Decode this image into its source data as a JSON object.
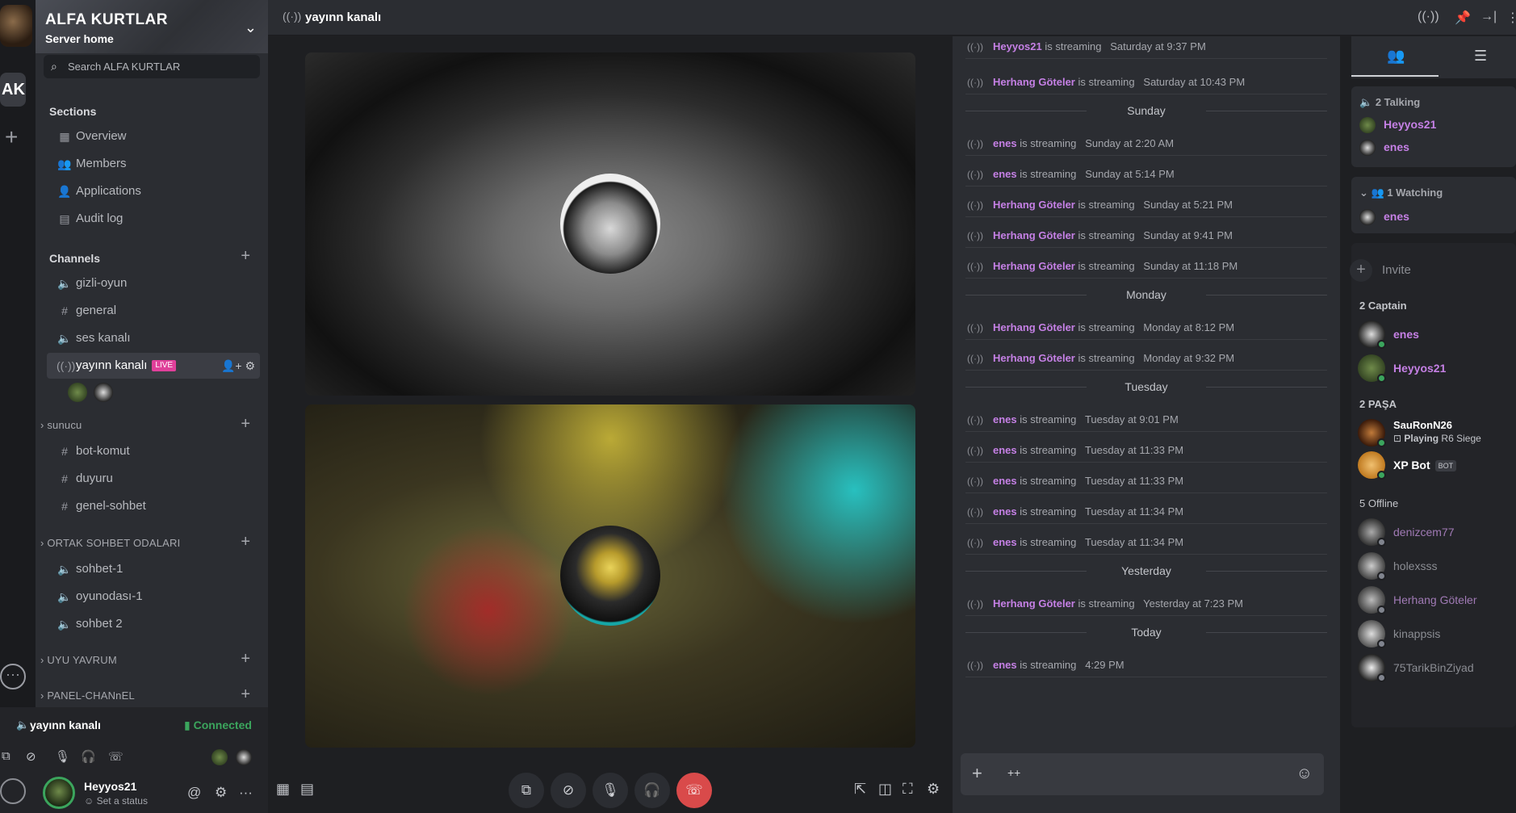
{
  "server": {
    "name": "ALFA KURTLAR",
    "subtitle": "Server home",
    "search_placeholder": "Search ALFA KURTLAR",
    "rail_label": "AK"
  },
  "sections": {
    "heading": "Sections",
    "items": [
      {
        "label": "Overview",
        "icon": "grid-icon"
      },
      {
        "label": "Members",
        "icon": "members-icon"
      },
      {
        "label": "Applications",
        "icon": "applications-icon"
      },
      {
        "label": "Audit log",
        "icon": "audit-log-icon"
      }
    ]
  },
  "channels": {
    "heading": "Channels",
    "top": [
      {
        "label": "gizli-oyun",
        "type": "voice"
      },
      {
        "label": "general",
        "type": "text"
      },
      {
        "label": "ses kanalı",
        "type": "voice"
      },
      {
        "label": "yayınn kanalı",
        "type": "stream",
        "badge": "LIVE"
      }
    ],
    "categories": [
      {
        "label": "sunucu",
        "channels": [
          "bot-komut",
          "duyuru",
          "genel-sohbet"
        ]
      },
      {
        "label": "ORTAK SOHBET ODALARI",
        "channels": [
          "sohbet-1",
          "oyunodası-1",
          "sohbet 2"
        ]
      },
      {
        "label": "UYU YAVRUM"
      },
      {
        "label": "PANEL-CHANnEL"
      }
    ]
  },
  "voice_panel": {
    "channel": "yayınn kanalı",
    "status": "Connected"
  },
  "user": {
    "name": "Heyyos21",
    "status": "Set a status"
  },
  "topbar": {
    "title": "yayınn kanalı"
  },
  "feed": {
    "verb": "is streaming",
    "rows": [
      {
        "kind": "event",
        "user": "Heyyos21",
        "time": "Saturday at 9:37 PM"
      },
      {
        "kind": "event",
        "user": "Herhang Göteler",
        "time": "Saturday at 10:43 PM"
      },
      {
        "kind": "day",
        "label": "Sunday"
      },
      {
        "kind": "event",
        "user": "enes",
        "time": "Sunday at 2:20 AM"
      },
      {
        "kind": "event",
        "user": "enes",
        "time": "Sunday at 5:14 PM"
      },
      {
        "kind": "event",
        "user": "Herhang Göteler",
        "time": "Sunday at 5:21 PM"
      },
      {
        "kind": "event",
        "user": "Herhang Göteler",
        "time": "Sunday at 9:41 PM"
      },
      {
        "kind": "event",
        "user": "Herhang Göteler",
        "time": "Sunday at 11:18 PM"
      },
      {
        "kind": "day",
        "label": "Monday"
      },
      {
        "kind": "event",
        "user": "Herhang Göteler",
        "time": "Monday at 8:12 PM"
      },
      {
        "kind": "event",
        "user": "Herhang Göteler",
        "time": "Monday at 9:32 PM"
      },
      {
        "kind": "day",
        "label": "Tuesday"
      },
      {
        "kind": "event",
        "user": "enes",
        "time": "Tuesday at 9:01 PM"
      },
      {
        "kind": "event",
        "user": "enes",
        "time": "Tuesday at 11:33 PM"
      },
      {
        "kind": "event",
        "user": "enes",
        "time": "Tuesday at 11:33 PM"
      },
      {
        "kind": "event",
        "user": "enes",
        "time": "Tuesday at 11:34 PM"
      },
      {
        "kind": "event",
        "user": "enes",
        "time": "Tuesday at 11:34 PM"
      },
      {
        "kind": "day",
        "label": "Yesterday"
      },
      {
        "kind": "event",
        "user": "Herhang Göteler",
        "time": "Yesterday at 7:23 PM"
      },
      {
        "kind": "day",
        "label": "Today"
      },
      {
        "kind": "event",
        "user": "enes",
        "time": "4:29 PM"
      }
    ],
    "composer_value": "++"
  },
  "members_panel": {
    "talking_label": "2 Talking",
    "talking": [
      "Heyyos21",
      "enes"
    ],
    "watching_label": "1 Watching",
    "watching": [
      "enes"
    ],
    "invite_label": "Invite",
    "groups": [
      {
        "label": "2 Captain",
        "members": [
          {
            "name": "enes"
          },
          {
            "name": "Heyyos21"
          }
        ]
      },
      {
        "label": "2 PAŞA",
        "members": [
          {
            "name": "SauRonN26",
            "activity_prefix": "Playing",
            "activity": "R6 Siege"
          },
          {
            "name": "XP Bot",
            "tag": "BOT"
          }
        ]
      },
      {
        "label": "5 Offline",
        "members": [
          {
            "name": "denizcem77"
          },
          {
            "name": "holexsss"
          },
          {
            "name": "Herhang Göteler"
          },
          {
            "name": "kinappsis"
          },
          {
            "name": "75TarikBinZiyad"
          }
        ]
      }
    ]
  },
  "colors": {
    "accent_username": "#c580e5",
    "connected": "#3ba55d",
    "live_badge": "#e0409a",
    "hangup": "#d94a4a"
  }
}
